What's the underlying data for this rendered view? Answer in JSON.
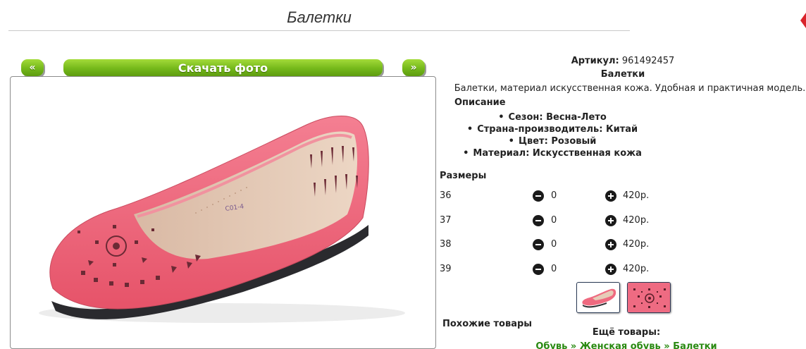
{
  "page": {
    "title": "Балетки"
  },
  "gallery": {
    "prev_label": "«",
    "download_label": "Скачать фото",
    "next_label": "»",
    "thumbs": [
      {
        "icon": "shoe-thumb"
      },
      {
        "icon": "pattern-thumb"
      }
    ]
  },
  "product": {
    "sku_label": "Артикул:",
    "sku_value": "961492457",
    "name": "Балетки",
    "short_description": "Балетки, материал искусственная кожа. Удобная и практичная модель.",
    "description_heading": "Описание",
    "attributes": [
      "Сезон: Весна-Лето",
      "Страна-производитель: Китай",
      "Цвет: Розовый",
      "Материал: Искусственная кожа"
    ]
  },
  "sizes": {
    "heading": "Размеры",
    "rows": [
      {
        "size": "36",
        "qty": "0",
        "price": "420р."
      },
      {
        "size": "37",
        "qty": "0",
        "price": "420р."
      },
      {
        "size": "38",
        "qty": "0",
        "price": "420р."
      },
      {
        "size": "39",
        "qty": "0",
        "price": "420р."
      }
    ]
  },
  "footer": {
    "similar_heading": "Похожие товары",
    "more_heading": "Ещё товары:",
    "breadcrumbs": [
      "Обувь",
      "Женская обувь",
      "Балетки"
    ],
    "breadcrumb_sep": "»"
  },
  "colors": {
    "accent_green": "#74b81a",
    "link_green": "#2a8a12",
    "shoe_pink": "#ef6a80"
  }
}
